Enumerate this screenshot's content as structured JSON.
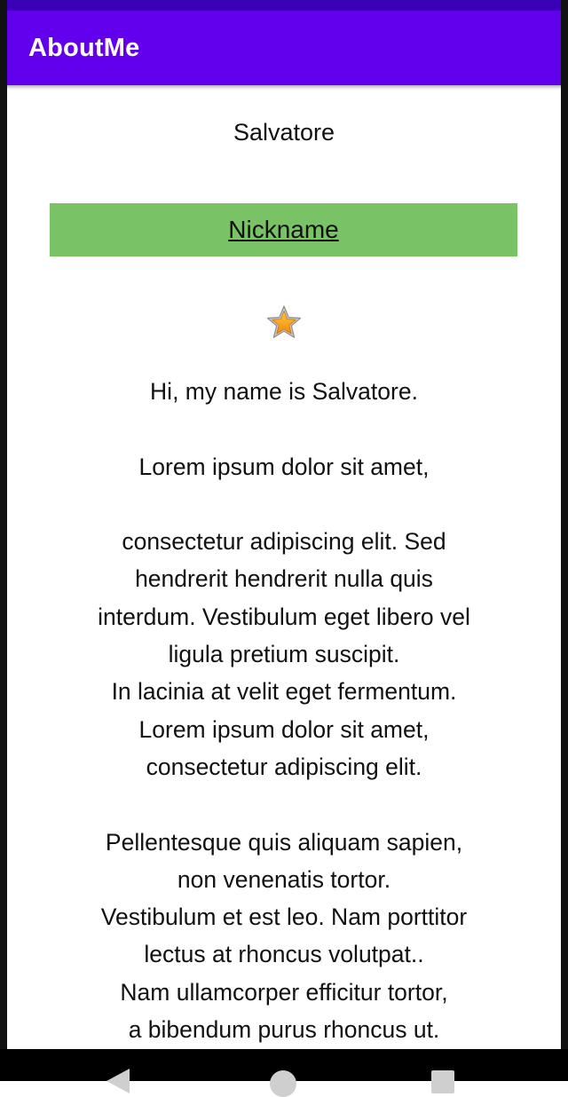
{
  "app_bar": {
    "title": "AboutMe"
  },
  "profile": {
    "name": "Salvatore",
    "nickname_button_label": "Nickname",
    "bio": "Hi, my name is Salvatore.\n\nLorem ipsum dolor sit amet,\n\nconsectetur adipiscing elit. Sed\nhendrerit hendrerit nulla quis\ninterdum. Vestibulum eget libero vel\nligula pretium suscipit.\nIn lacinia at velit eget fermentum.\nLorem ipsum dolor sit amet,\nconsectetur adipiscing elit.\n\nPellentesque quis aliquam sapien,\nnon venenatis tortor.\nVestibulum et est leo. Nam porttitor\nlectus at rhoncus volutpat..\nNam ullamcorper efficitur tortor,\na bibendum purus rhoncus ut."
  },
  "icons": {
    "star": "star-icon",
    "nav_back": "back-triangle-icon",
    "nav_home": "home-circle-icon",
    "nav_recents": "recents-square-icon"
  },
  "colors": {
    "status_bar": "#3a00b8",
    "app_bar": "#6200ee",
    "nickname_button": "#79c265",
    "star_fill": "#f7a21b",
    "nav_bar": "#000000"
  }
}
